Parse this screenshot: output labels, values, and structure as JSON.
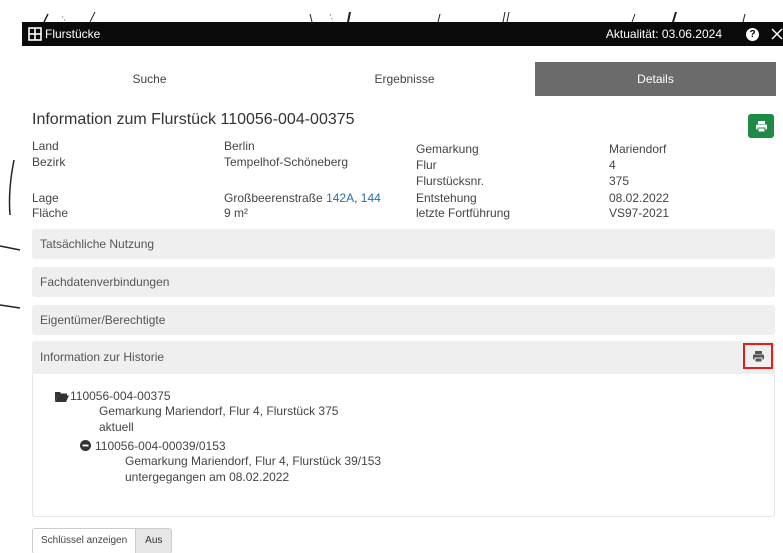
{
  "window": {
    "title": "Flurstücke",
    "date": "Aktualität: 03.06.2024"
  },
  "tabs": [
    {
      "label": "Suche"
    },
    {
      "label": "Ergebnisse"
    },
    {
      "label": "Details",
      "active": true
    }
  ],
  "heading": "Information zum Flurstück 110056-004-00375",
  "info_left": [
    {
      "label": "Land",
      "value": "Berlin"
    },
    {
      "label": "Bezirk",
      "value": "Tempelhof-Schöneberg"
    },
    {
      "label": "Lage",
      "value_prefix": "Großbeerenstraße",
      "links": [
        "142A",
        "144"
      ]
    },
    {
      "label": "Fläche",
      "value": "9 m²"
    }
  ],
  "info_right": [
    {
      "label": "Gemarkung",
      "value": "Mariendorf"
    },
    {
      "label": "Flur",
      "value": "4"
    },
    {
      "label": "Flurstücksnr.",
      "value": "375"
    },
    {
      "label": "Entstehung",
      "value": "08.02.2022"
    },
    {
      "label": "letzte Fortführung",
      "value": "VS97-2021"
    }
  ],
  "sections": [
    {
      "label": "Tatsächliche Nutzung"
    },
    {
      "label": "Fachdatenverbindungen"
    },
    {
      "label": "Eigentümer/Berechtigte"
    },
    {
      "label": "Information zur Historie",
      "expanded": true
    }
  ],
  "history": {
    "root": {
      "id": "110056-004-00375",
      "desc": "Gemarkung Mariendorf, Flur 4, Flurstück 375",
      "status": "aktuell"
    },
    "child": {
      "id": "110056-004-00039/0153",
      "desc": "Gemarkung Mariendorf, Flur 4, Flurstück 39/153",
      "status": "untergegangen am 08.02.2022"
    }
  },
  "key_toggle": {
    "label": "Schlüssel anzeigen",
    "value": "Aus"
  },
  "colors": {
    "titlebar": "#0a0a0a",
    "active_tab": "#6b6b6b",
    "print_button": "#1e8a46",
    "highlight": "#e02020",
    "link": "#2a6db0"
  },
  "icons": [
    "grid-icon",
    "help-icon",
    "close-icon",
    "printer-icon",
    "folder-open-icon",
    "minus-circle-icon"
  ]
}
